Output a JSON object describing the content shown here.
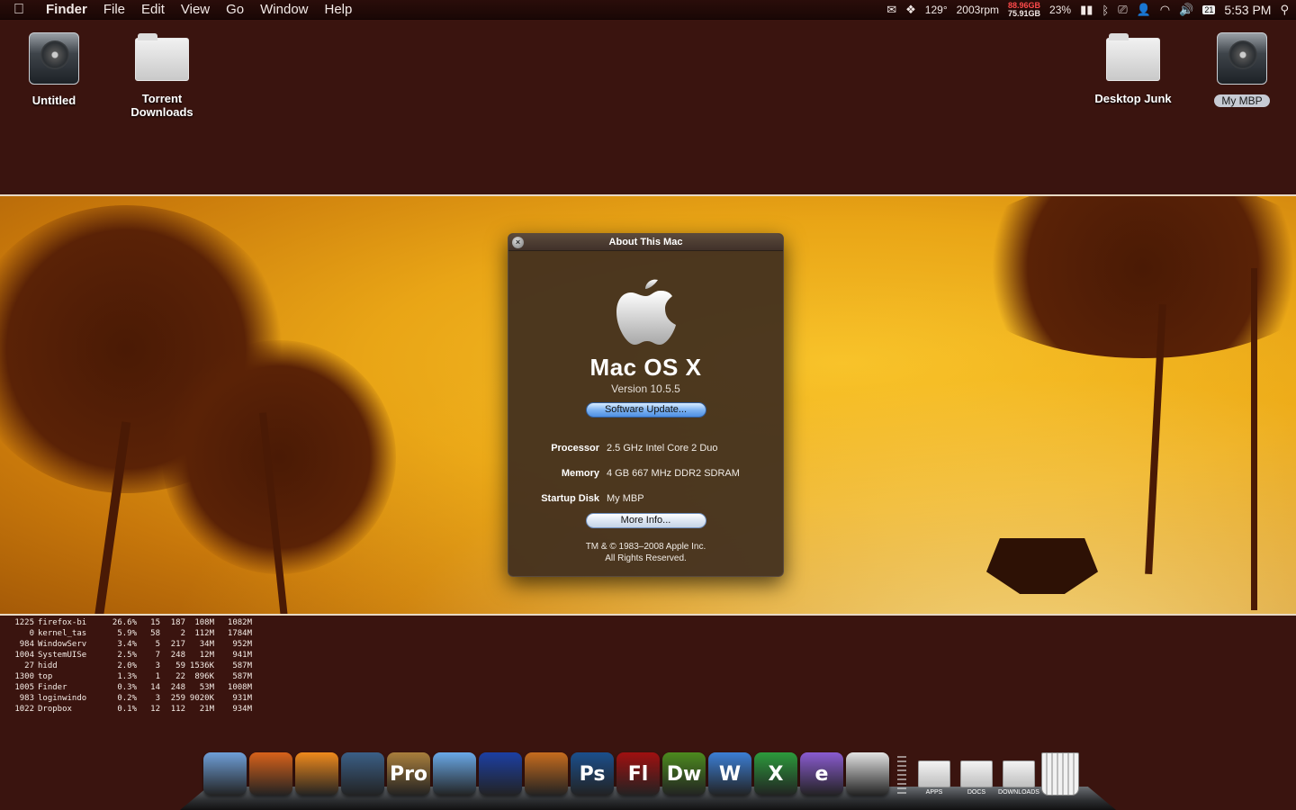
{
  "menubar": {
    "apple_icon": "apple-icon",
    "app_name": "Finder",
    "items": [
      "File",
      "Edit",
      "View",
      "Go",
      "Window",
      "Help"
    ],
    "status": {
      "temperature": "129°",
      "fan_speed": "2003rpm",
      "disk_used": "88.96GB",
      "disk_free": "75.91GB",
      "battery": "23%",
      "calendar_day": "21",
      "clock": "5:53 PM"
    }
  },
  "desktop": {
    "icons_left": [
      {
        "label": "Untitled",
        "kind": "hard-drive"
      },
      {
        "label": "Torrent Downloads",
        "kind": "folder"
      }
    ],
    "icons_right": [
      {
        "label": "Desktop Junk",
        "kind": "folder"
      },
      {
        "label": "My MBP",
        "kind": "hard-drive",
        "selected": true
      }
    ]
  },
  "about_window": {
    "title": "About This Mac",
    "os_name": "Mac OS X",
    "version": "Version 10.5.5",
    "software_update_button": "Software Update...",
    "specs": [
      {
        "label": "Processor",
        "value": "2.5 GHz Intel Core 2 Duo"
      },
      {
        "label": "Memory",
        "value": "4 GB 667 MHz DDR2 SDRAM"
      },
      {
        "label": "Startup Disk",
        "value": "My MBP"
      }
    ],
    "more_info_button": "More Info...",
    "copyright_line1": "TM & © 1983–2008 Apple Inc.",
    "copyright_line2": "All Rights Reserved."
  },
  "processes": [
    {
      "pid": "1225",
      "cmd": "firefox-bi",
      "cpu": "26.6%",
      "th": "15",
      "ports": "187",
      "rsize": "108M",
      "vsize": "1082M"
    },
    {
      "pid": "0",
      "cmd": "kernel_tas",
      "cpu": "5.9%",
      "th": "58",
      "ports": "2",
      "rsize": "112M",
      "vsize": "1784M"
    },
    {
      "pid": "984",
      "cmd": "WindowServ",
      "cpu": "3.4%",
      "th": "5",
      "ports": "217",
      "rsize": "34M",
      "vsize": "952M"
    },
    {
      "pid": "1004",
      "cmd": "SystemUISe",
      "cpu": "2.5%",
      "th": "7",
      "ports": "248",
      "rsize": "12M",
      "vsize": "941M"
    },
    {
      "pid": "27",
      "cmd": "hidd",
      "cpu": "2.0%",
      "th": "3",
      "ports": "59",
      "rsize": "1536K",
      "vsize": "587M"
    },
    {
      "pid": "1300",
      "cmd": "top",
      "cpu": "1.3%",
      "th": "1",
      "ports": "22",
      "rsize": "896K",
      "vsize": "587M"
    },
    {
      "pid": "1005",
      "cmd": "Finder",
      "cpu": "0.3%",
      "th": "14",
      "ports": "248",
      "rsize": "53M",
      "vsize": "1008M"
    },
    {
      "pid": "983",
      "cmd": "loginwindo",
      "cpu": "0.2%",
      "th": "3",
      "ports": "259",
      "rsize": "9020K",
      "vsize": "931M"
    },
    {
      "pid": "1022",
      "cmd": "Dropbox",
      "cpu": "0.1%",
      "th": "12",
      "ports": "112",
      "rsize": "21M",
      "vsize": "934M"
    }
  ],
  "dock": {
    "apps": [
      {
        "name": "finder-icon",
        "text": "",
        "color": "#6f9fd8"
      },
      {
        "name": "firefox-icon",
        "text": "",
        "color": "#d8621a"
      },
      {
        "name": "vlc-icon",
        "text": "",
        "color": "#f08a1c"
      },
      {
        "name": "quicktime-icon",
        "text": "",
        "color": "#3b5f86"
      },
      {
        "name": "logic-pro-icon",
        "text": "Pro",
        "color": "#a97e3c"
      },
      {
        "name": "itunes-icon",
        "text": "",
        "color": "#6aa9e8"
      },
      {
        "name": "audacity-icon",
        "text": "",
        "color": "#1c3fa3"
      },
      {
        "name": "reason-icon",
        "text": "",
        "color": "#c66c1e"
      },
      {
        "name": "photoshop-icon",
        "text": "Ps",
        "color": "#1b4f8c"
      },
      {
        "name": "flash-icon",
        "text": "Fl",
        "color": "#a01010"
      },
      {
        "name": "dreamweaver-icon",
        "text": "Dw",
        "color": "#4c8a1e"
      },
      {
        "name": "word-icon",
        "text": "W",
        "color": "#3c7fd6"
      },
      {
        "name": "excel-icon",
        "text": "X",
        "color": "#2c9a3c"
      },
      {
        "name": "entourage-icon",
        "text": "e",
        "color": "#8a5bd0"
      },
      {
        "name": "transmission-icon",
        "text": "",
        "color": "#e2e2e2"
      }
    ],
    "stacks": [
      {
        "name": "apps-stack-icon",
        "label": "APPS"
      },
      {
        "name": "docs-stack-icon",
        "label": "DOCS"
      },
      {
        "name": "downloads-stack-icon",
        "label": "DOWNLOADS"
      }
    ],
    "trash_icon": "trash-icon"
  }
}
